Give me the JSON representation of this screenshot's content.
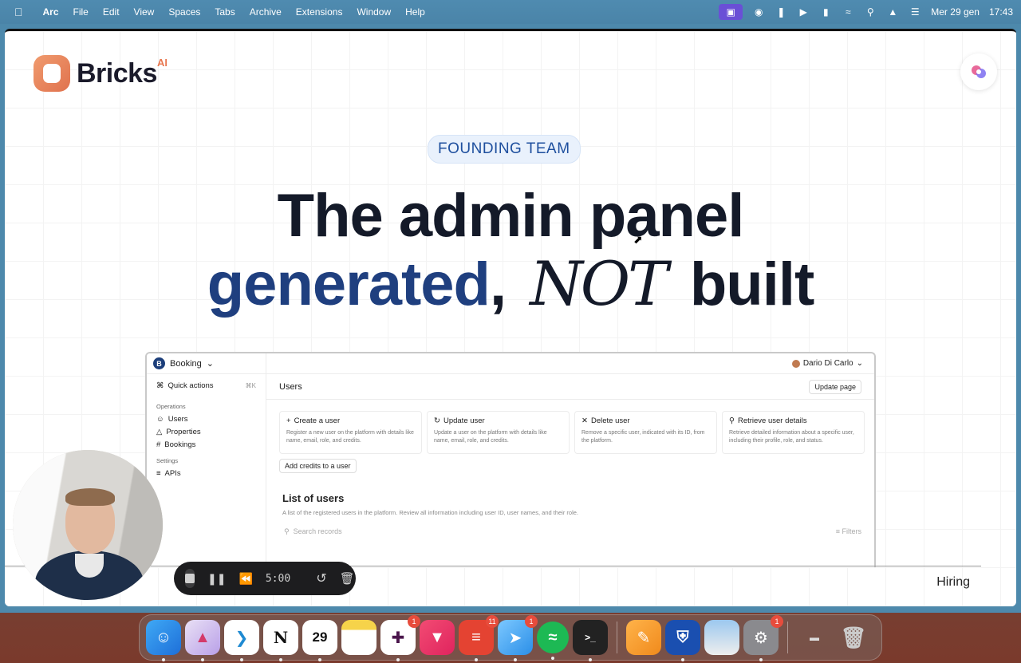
{
  "menubar": {
    "app_name": "Arc",
    "items": [
      "File",
      "Edit",
      "View",
      "Spaces",
      "Tabs",
      "Archive",
      "Extensions",
      "Window",
      "Help"
    ],
    "date": "Mer 29 gen",
    "time": "17:43"
  },
  "page": {
    "logo_text": "Bricks",
    "logo_suffix": "AI",
    "badge": "FOUNDING TEAM",
    "headline_line1": "The admin panel",
    "headline_blue": "generated",
    "headline_comma": ",",
    "headline_hand": "NOT",
    "headline_end": "built",
    "footer_link": "Hiring"
  },
  "admin": {
    "project": "Booking",
    "project_initial": "B",
    "user": "Dario Di Carlo",
    "quick_actions": "Quick actions",
    "quick_shortcut": "⌘K",
    "section_operations": "Operations",
    "nav_users": "Users",
    "nav_properties": "Properties",
    "nav_bookings": "Bookings",
    "section_settings": "Settings",
    "nav_apis": "APIs",
    "page_title": "Users",
    "update_page": "Update page",
    "cards": [
      {
        "title": "Create a user",
        "desc": "Register a new user on the platform with details like name, email, role, and credits."
      },
      {
        "title": "Update user",
        "desc": "Update a user on the platform with details like name, email, role, and credits."
      },
      {
        "title": "Delete user",
        "desc": "Remove a specific user, indicated with its ID, from the platform."
      },
      {
        "title": "Retrieve user details",
        "desc": "Retrieve detailed information about a specific user, including their profile, role, and status."
      }
    ],
    "add_credits": "Add credits to a user",
    "list_title": "List of users",
    "list_desc": "A list of the registered users in the platform. Review all information including user ID, user names, and their role.",
    "search_placeholder": "Search records",
    "filters": "Filters"
  },
  "recorder": {
    "time": "5:00"
  },
  "dock": {
    "badges": {
      "slack": "1",
      "todoist": "11",
      "spark": "1",
      "settings": "1"
    },
    "calendar_day": "29"
  }
}
